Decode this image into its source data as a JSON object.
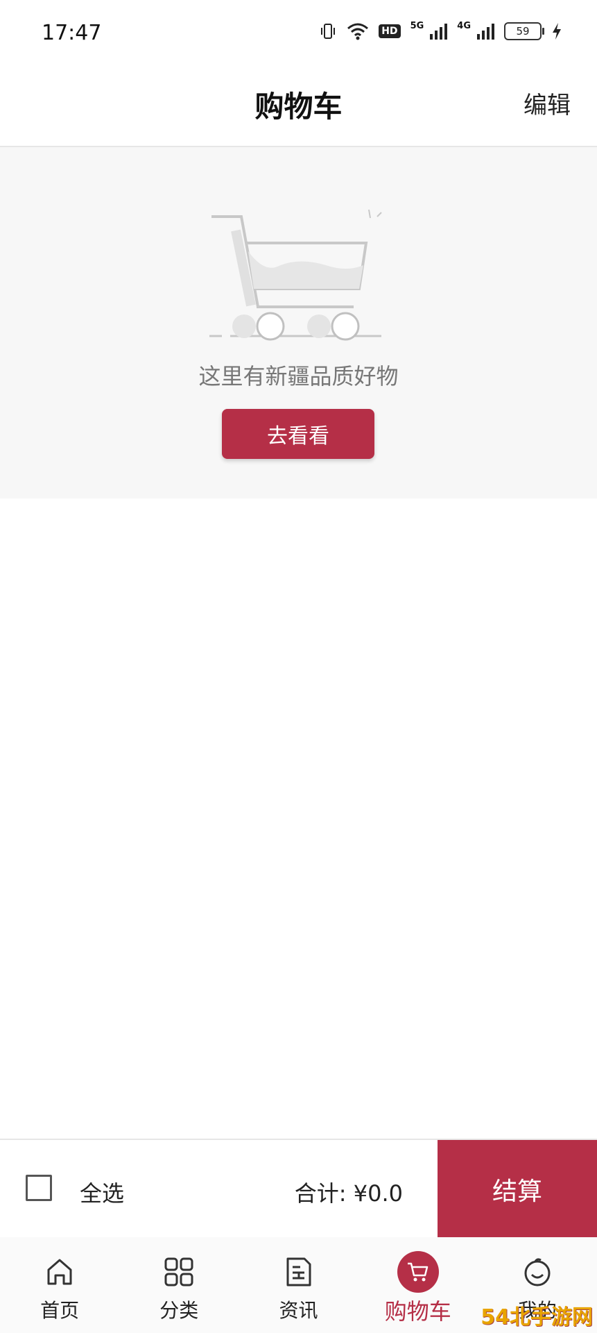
{
  "status_bar": {
    "time": "17:47",
    "hd_label": "HD",
    "net_5g": "5G",
    "net_4g": "4G",
    "battery": "59"
  },
  "header": {
    "title": "购物车",
    "edit_label": "编辑"
  },
  "empty_state": {
    "message": "这里有新疆品质好物",
    "button_label": "去看看",
    "icon": "shopping-cart-illustration"
  },
  "checkout": {
    "select_all_label": "全选",
    "total_label": "合计: ¥0.0",
    "checkout_label": "结算"
  },
  "tabs": [
    {
      "label": "首页",
      "icon": "home-icon"
    },
    {
      "label": "分类",
      "icon": "grid-icon"
    },
    {
      "label": "资讯",
      "icon": "news-icon"
    },
    {
      "label": "购物车",
      "icon": "cart-icon",
      "active": true
    },
    {
      "label": "我的",
      "icon": "user-icon"
    }
  ],
  "colors": {
    "accent": "#b52f47",
    "empty_bg": "#f7f7f7"
  },
  "watermark": "54北手游网"
}
